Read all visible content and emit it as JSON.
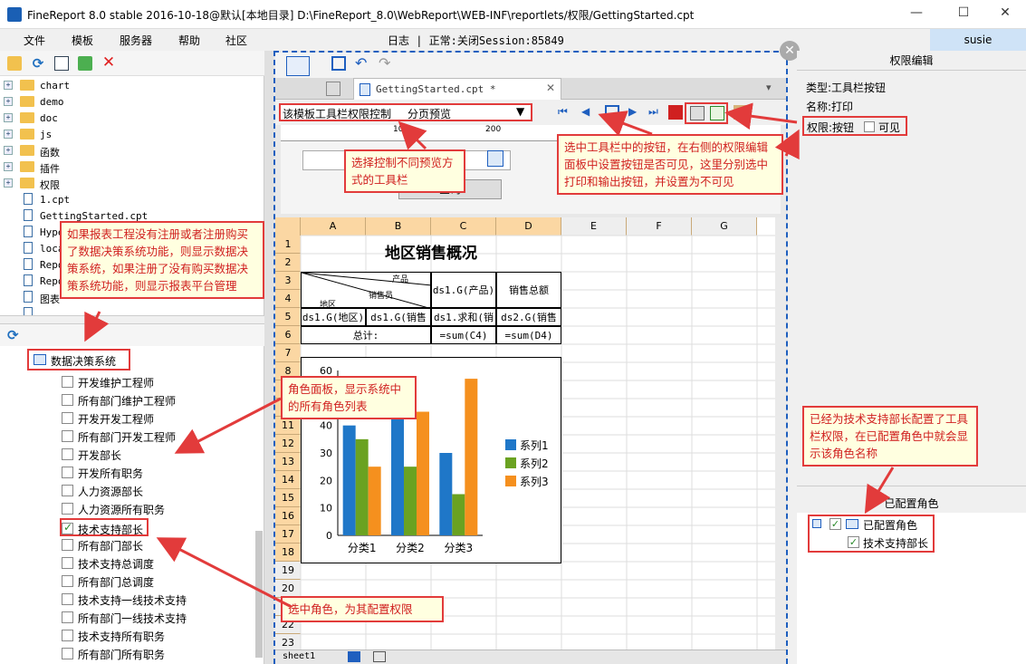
{
  "window": {
    "title": "FineReport 8.0 stable 2016-10-18@默认[本地目录]    D:\\FineReport_8.0\\WebReport\\WEB-INF\\reportlets/权限/GettingStarted.cpt"
  },
  "menu": [
    "文件",
    "模板",
    "服务器",
    "帮助",
    "社区"
  ],
  "status_log": "日志 | 正常:关闭Session:85849",
  "user": "susie",
  "file_tree": [
    {
      "label": "chart",
      "type": "folder"
    },
    {
      "label": "demo",
      "type": "folder"
    },
    {
      "label": "doc",
      "type": "folder"
    },
    {
      "label": "js",
      "type": "folder"
    },
    {
      "label": "函数",
      "type": "folder"
    },
    {
      "label": "插件",
      "type": "folder"
    },
    {
      "label": "权限",
      "type": "folder"
    },
    {
      "label": "1.cpt",
      "type": "file"
    },
    {
      "label": "GettingStarted.cpt",
      "type": "file"
    },
    {
      "label": "Hyper",
      "type": "file"
    },
    {
      "label": "local",
      "type": "file"
    },
    {
      "label": "Repor",
      "type": "file"
    },
    {
      "label": "Repor",
      "type": "file"
    },
    {
      "label": "图表",
      "type": "file"
    },
    {
      "label": "",
      "type": "file"
    }
  ],
  "role_panel": {
    "root": "数据决策系统",
    "roles": [
      {
        "label": "开发维护工程师",
        "checked": false
      },
      {
        "label": "所有部门维护工程师",
        "checked": false
      },
      {
        "label": "开发开发工程师",
        "checked": false
      },
      {
        "label": "所有部门开发工程师",
        "checked": false
      },
      {
        "label": "开发部长",
        "checked": false
      },
      {
        "label": "开发所有职务",
        "checked": false
      },
      {
        "label": "人力资源部长",
        "checked": false
      },
      {
        "label": "人力资源所有职务",
        "checked": false
      },
      {
        "label": "技术支持部长",
        "checked": true
      },
      {
        "label": "所有部门部长",
        "checked": false
      },
      {
        "label": "技术支持总调度",
        "checked": false
      },
      {
        "label": "所有部门总调度",
        "checked": false
      },
      {
        "label": "技术支持一线技术支持",
        "checked": false
      },
      {
        "label": "所有部门一线技术支持",
        "checked": false
      },
      {
        "label": "技术支持所有职务",
        "checked": false
      },
      {
        "label": "所有部门所有职务",
        "checked": false
      }
    ]
  },
  "editor": {
    "tab": "GettingStarted.cpt *",
    "toolbar_select": "该模板工具栏权限控制",
    "mode_select": "分页预览",
    "query_button": "查询",
    "ruler_marks": [
      "100",
      "200"
    ],
    "columns": [
      "A",
      "B",
      "C",
      "D",
      "E",
      "F",
      "G"
    ],
    "rows": [
      "1",
      "2",
      "3",
      "4",
      "5",
      "6",
      "7",
      "8",
      "9",
      "10",
      "11",
      "12",
      "13",
      "14",
      "15",
      "16",
      "17",
      "18",
      "19",
      "20",
      "21",
      "22",
      "23"
    ],
    "report_title": "地区销售概况",
    "header_diag": {
      "product": "产品",
      "sales": "销售员",
      "region": "地区"
    },
    "cells": {
      "c3": "ds1.G(产品)",
      "d3": "销售总额",
      "a4": "ds1.G(地区)",
      "b4": "ds1.G(销售",
      "c4": "ds1.求和(销",
      "d4": "ds2.G(销售",
      "total": "总计:",
      "c5": "=sum(C4)",
      "d5": "=sum(D4)"
    },
    "sheet_tab": "sheet1"
  },
  "chart_data": {
    "type": "bar",
    "categories": [
      "分类1",
      "分类2",
      "分类3"
    ],
    "series": [
      {
        "name": "系列1",
        "values": [
          40,
          43,
          30
        ],
        "color": "#1f77c8"
      },
      {
        "name": "系列2",
        "values": [
          35,
          25,
          15
        ],
        "color": "#6aa221"
      },
      {
        "name": "系列3",
        "values": [
          25,
          45,
          57
        ],
        "color": "#f5901e"
      }
    ],
    "ylim": [
      0,
      60
    ],
    "yticks": [
      "0",
      "10",
      "20",
      "30",
      "40",
      "50",
      "60"
    ],
    "legend": "right"
  },
  "right_panel": {
    "header": "权限编辑",
    "type_label": "类型:工具栏按钮",
    "name_label": "名称:打印",
    "perm_label": "权限:按钮",
    "visible_label": "可见",
    "configured_header": "已配置角色",
    "configured_root": "已配置角色",
    "configured_item": "技术支持部长"
  },
  "callouts": {
    "left_top": "如果报表工程没有注册或者注册购买了数据决策系统功能，则显示数据决策系统，如果注册了没有购买数据决策系统功能，则显示报表平台管理",
    "role_panel": "角色面板，显示系统中的所有角色列表",
    "select_role": "选中角色，为其配置权限",
    "toolbar_select": "选择控制不同预览方式的工具栏",
    "toolbar_button": "选中工具栏中的按钮，在右侧的权限编辑面板中设置按钮是否可见，这里分别选中打印和输出按钮，并设置为不可见",
    "configured": "已经为技术支持部长配置了工具栏权限，在已配置角色中就会显示该角色名称"
  }
}
